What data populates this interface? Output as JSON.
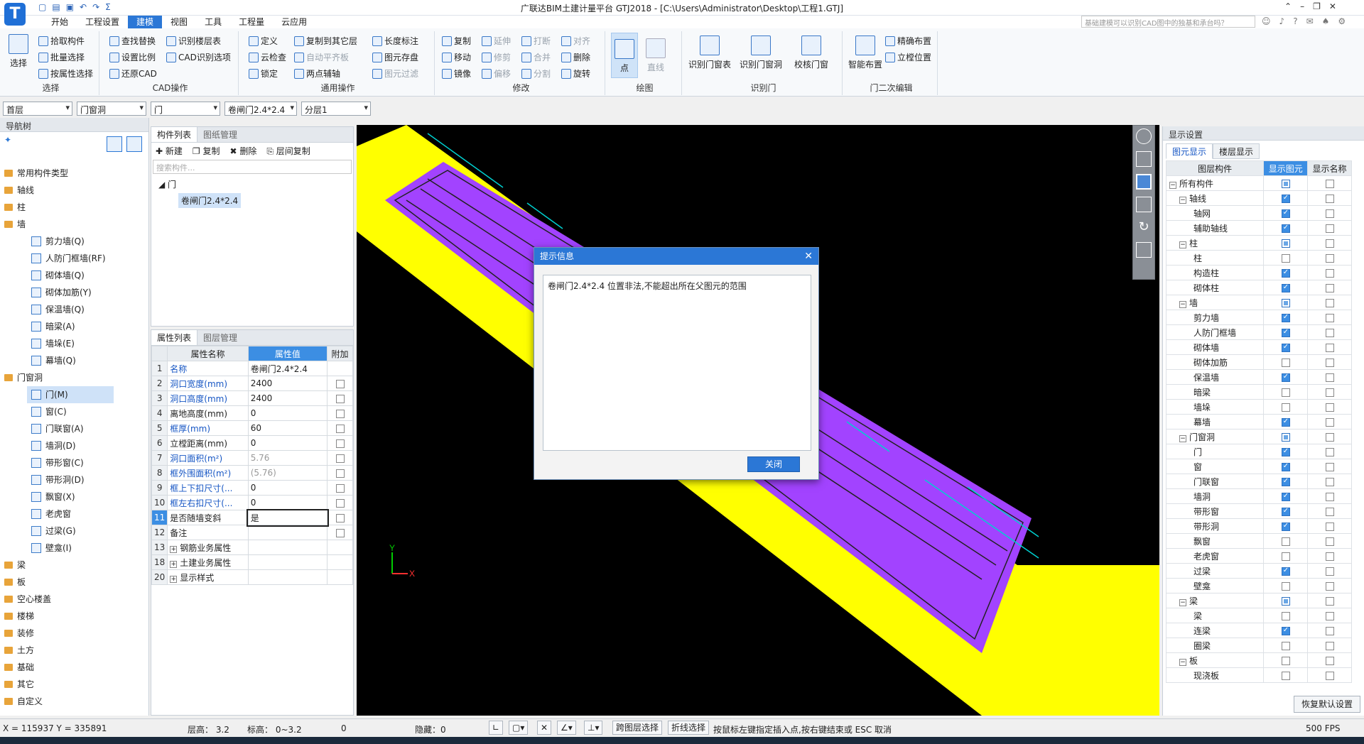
{
  "app": {
    "title": "广联达BIM土建计量平台 GTJ2018 - [C:\\Users\\Administrator\\Desktop\\工程1.GTJ]",
    "logo": "T",
    "search_placeholder": "基础建模可以识别CAD图中的独基和承台吗？"
  },
  "menu_tabs": [
    "开始",
    "工程设置",
    "建模",
    "视图",
    "工具",
    "工程量",
    "云应用"
  ],
  "ribbon": {
    "select": {
      "big": "选择",
      "items": [
        "拾取构件",
        "批量选择",
        "按属性选择"
      ],
      "label": "选择"
    },
    "cad": {
      "items": [
        "查找替换",
        "识别楼层表",
        "设置比例",
        "CAD识别选项",
        "还原CAD"
      ],
      "label": "CAD操作"
    },
    "general": {
      "items": [
        "定义",
        "复制到其它层",
        "长度标注",
        "云检查",
        "自动平齐板",
        "图元存盘",
        "锁定",
        "两点辅轴",
        "图元过滤"
      ],
      "label": "通用操作"
    },
    "modify": {
      "items": [
        "复制",
        "延伸",
        "打断",
        "对齐",
        "移动",
        "修剪",
        "合并",
        "删除",
        "镜像",
        "偏移",
        "分割",
        "旋转"
      ],
      "label": "修改"
    },
    "draw": {
      "items": [
        "点",
        "直线"
      ],
      "label": "绘图"
    },
    "recognize": {
      "items": [
        "识别门窗表",
        "识别门窗洞",
        "校核门窗"
      ],
      "label": "识别门"
    },
    "edit2": {
      "items": [
        "智能布置",
        "精确布置",
        "立樘位置"
      ],
      "label": "门二次编辑"
    }
  },
  "selectors": [
    "首层",
    "门窗洞",
    "门",
    "卷闸门2.4*2.4",
    "分层1"
  ],
  "nav": {
    "title": "导航树",
    "items": [
      {
        "label": "常用构件类型",
        "level": 1
      },
      {
        "label": "轴线",
        "level": 1
      },
      {
        "label": "柱",
        "level": 1
      },
      {
        "label": "墙",
        "level": 1
      },
      {
        "label": "剪力墙(Q)",
        "level": 2
      },
      {
        "label": "人防门框墙(RF)",
        "level": 2
      },
      {
        "label": "砌体墙(Q)",
        "level": 2
      },
      {
        "label": "砌体加筋(Y)",
        "level": 2
      },
      {
        "label": "保温墙(Q)",
        "level": 2
      },
      {
        "label": "暗梁(A)",
        "level": 2
      },
      {
        "label": "墙垛(E)",
        "level": 2
      },
      {
        "label": "幕墙(Q)",
        "level": 2
      },
      {
        "label": "门窗洞",
        "level": 1
      },
      {
        "label": "门(M)",
        "level": 2,
        "selected": true
      },
      {
        "label": "窗(C)",
        "level": 2
      },
      {
        "label": "门联窗(A)",
        "level": 2
      },
      {
        "label": "墙洞(D)",
        "level": 2
      },
      {
        "label": "带形窗(C)",
        "level": 2
      },
      {
        "label": "带形洞(D)",
        "level": 2
      },
      {
        "label": "飘窗(X)",
        "level": 2
      },
      {
        "label": "老虎窗",
        "level": 2
      },
      {
        "label": "过梁(G)",
        "level": 2
      },
      {
        "label": "壁龛(I)",
        "level": 2
      },
      {
        "label": "梁",
        "level": 1
      },
      {
        "label": "板",
        "level": 1
      },
      {
        "label": "空心楼盖",
        "level": 1
      },
      {
        "label": "楼梯",
        "level": 1
      },
      {
        "label": "装修",
        "level": 1
      },
      {
        "label": "土方",
        "level": 1
      },
      {
        "label": "基础",
        "level": 1
      },
      {
        "label": "其它",
        "level": 1
      },
      {
        "label": "自定义",
        "level": 1
      }
    ]
  },
  "component_list": {
    "tabs": [
      "构件列表",
      "图纸管理"
    ],
    "toolbar": [
      "新建",
      "复制",
      "删除",
      "层间复制"
    ],
    "search_placeholder": "搜索构件...",
    "root": "门",
    "child": "卷闸门2.4*2.4"
  },
  "properties": {
    "tabs": [
      "属性列表",
      "图层管理"
    ],
    "headers": [
      "属性名称",
      "属性值",
      "附加"
    ],
    "rows": [
      {
        "n": "1",
        "name": "名称",
        "value": "卷闸门2.4*2.4",
        "blue": true,
        "chk": false,
        "hasChk": false
      },
      {
        "n": "2",
        "name": "洞口宽度(mm)",
        "value": "2400",
        "blue": true,
        "hasChk": true
      },
      {
        "n": "3",
        "name": "洞口高度(mm)",
        "value": "2400",
        "blue": true,
        "hasChk": true
      },
      {
        "n": "4",
        "name": "离地高度(mm)",
        "value": "0",
        "blue": false,
        "hasChk": true
      },
      {
        "n": "5",
        "name": "框厚(mm)",
        "value": "60",
        "blue": true,
        "hasChk": true
      },
      {
        "n": "6",
        "name": "立樘距离(mm)",
        "value": "0",
        "blue": false,
        "hasChk": true
      },
      {
        "n": "7",
        "name": "洞口面积(m²)",
        "value": "5.76",
        "blue": true,
        "gray": true,
        "hasChk": true
      },
      {
        "n": "8",
        "name": "框外围面积(m²)",
        "value": "(5.76)",
        "blue": true,
        "gray": true,
        "hasChk": true
      },
      {
        "n": "9",
        "name": "框上下扣尺寸(...",
        "value": "0",
        "blue": true,
        "hasChk": true
      },
      {
        "n": "10",
        "name": "框左右扣尺寸(...",
        "value": "0",
        "blue": true,
        "hasChk": true
      },
      {
        "n": "11",
        "name": "是否随墙变斜",
        "value": "是",
        "blue": false,
        "hasChk": true,
        "selected": true
      },
      {
        "n": "12",
        "name": "备注",
        "value": "",
        "blue": false,
        "hasChk": true
      },
      {
        "n": "13",
        "name": "钢筋业务属性",
        "value": "",
        "blue": false,
        "hasChk": false,
        "group": true
      },
      {
        "n": "18",
        "name": "土建业务属性",
        "value": "",
        "blue": false,
        "hasChk": false,
        "group": true
      },
      {
        "n": "20",
        "name": "显示样式",
        "value": "",
        "blue": false,
        "hasChk": false,
        "group": true
      }
    ]
  },
  "dialog": {
    "title": "提示信息",
    "message": "卷闸门2.4*2.4 位置非法,不能超出所在父图元的范围",
    "close_button": "关闭"
  },
  "display": {
    "title": "显示设置",
    "tabs": [
      "图元显示",
      "楼层显示"
    ],
    "headers": [
      "图层构件",
      "显示图元",
      "显示名称"
    ],
    "rows": [
      {
        "label": "所有构件",
        "level": 0,
        "exp": true,
        "show": "part",
        "name": false
      },
      {
        "label": "轴线",
        "level": 1,
        "exp": true,
        "show": "on",
        "name": false
      },
      {
        "label": "轴网",
        "level": 2,
        "show": "on",
        "name": false
      },
      {
        "label": "辅助轴线",
        "level": 2,
        "show": "on",
        "name": false
      },
      {
        "label": "柱",
        "level": 1,
        "exp": true,
        "show": "part",
        "name": false
      },
      {
        "label": "柱",
        "level": 2,
        "show": "off",
        "name": false
      },
      {
        "label": "构造柱",
        "level": 2,
        "show": "on",
        "name": false
      },
      {
        "label": "砌体柱",
        "level": 2,
        "show": "on",
        "name": false
      },
      {
        "label": "墙",
        "level": 1,
        "exp": true,
        "show": "part",
        "name": false
      },
      {
        "label": "剪力墙",
        "level": 2,
        "show": "on",
        "name": false
      },
      {
        "label": "人防门框墙",
        "level": 2,
        "show": "on",
        "name": false
      },
      {
        "label": "砌体墙",
        "level": 2,
        "show": "on",
        "name": false
      },
      {
        "label": "砌体加筋",
        "level": 2,
        "show": "off",
        "name": false
      },
      {
        "label": "保温墙",
        "level": 2,
        "show": "on",
        "name": false
      },
      {
        "label": "暗梁",
        "level": 2,
        "show": "off",
        "name": false
      },
      {
        "label": "墙垛",
        "level": 2,
        "show": "off",
        "name": false
      },
      {
        "label": "幕墙",
        "level": 2,
        "show": "on",
        "name": false
      },
      {
        "label": "门窗洞",
        "level": 1,
        "exp": true,
        "show": "part",
        "name": false
      },
      {
        "label": "门",
        "level": 2,
        "show": "on",
        "name": false
      },
      {
        "label": "窗",
        "level": 2,
        "show": "on",
        "name": false
      },
      {
        "label": "门联窗",
        "level": 2,
        "show": "on",
        "name": false
      },
      {
        "label": "墙洞",
        "level": 2,
        "show": "on",
        "name": false
      },
      {
        "label": "带形窗",
        "level": 2,
        "show": "on",
        "name": false
      },
      {
        "label": "带形洞",
        "level": 2,
        "show": "on",
        "name": false
      },
      {
        "label": "飘窗",
        "level": 2,
        "show": "off",
        "name": false
      },
      {
        "label": "老虎窗",
        "level": 2,
        "show": "off",
        "name": false
      },
      {
        "label": "过梁",
        "level": 2,
        "show": "on",
        "name": false
      },
      {
        "label": "壁龛",
        "level": 2,
        "show": "off",
        "name": false
      },
      {
        "label": "梁",
        "level": 1,
        "exp": true,
        "show": "part",
        "name": false
      },
      {
        "label": "梁",
        "level": 2,
        "show": "off",
        "name": false
      },
      {
        "label": "连梁",
        "level": 2,
        "show": "on",
        "name": false
      },
      {
        "label": "圈梁",
        "level": 2,
        "show": "off",
        "name": false
      },
      {
        "label": "板",
        "level": 1,
        "exp": true,
        "show": "off",
        "name": false
      },
      {
        "label": "现浇板",
        "level": 2,
        "show": "off",
        "name": false
      }
    ],
    "restore_button": "恢复默认设置"
  },
  "status": {
    "coords": "X = 115937 Y = 335891",
    "floor_height": "层高： 3.2",
    "elevation": "标高： 0~3.2",
    "zero": "0",
    "hidden": "隐藏：0",
    "cross_layer": "跨图层选择",
    "polyline": "折线选择",
    "hint": "按鼠标左键指定插入点,按右键结束或 ESC 取消",
    "fps": "500 FPS"
  },
  "colors": {
    "accent": "#2b77d6",
    "wall": "#ffff00",
    "door": "#9933ff",
    "axis": "#00d0d0"
  }
}
